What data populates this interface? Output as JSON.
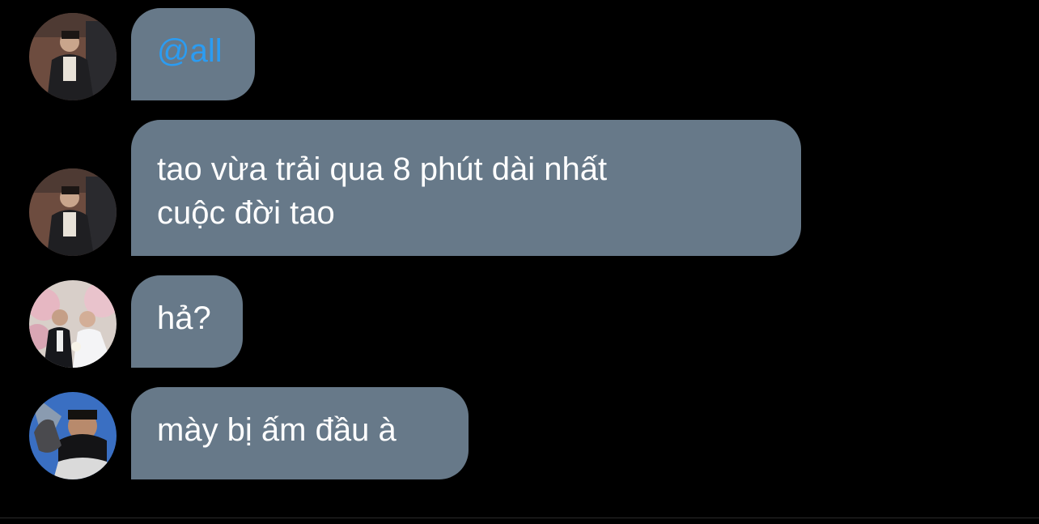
{
  "messages": [
    {
      "avatar_icon": "avatar-icon",
      "text": "@all",
      "is_mention": true
    },
    {
      "avatar_icon": "avatar-icon",
      "lines": [
        "tao vừa trải qua 8 phút dài nhất",
        "cuộc đời tao"
      ]
    },
    {
      "avatar_icon": "avatar-icon",
      "text": "hả?"
    },
    {
      "avatar_icon": "avatar-icon",
      "text": "mày bị ấm đầu à"
    }
  ],
  "colors": {
    "background": "#000000",
    "bubble": "#677989",
    "text": "#ffffff",
    "mention": "#2b9cf2"
  }
}
